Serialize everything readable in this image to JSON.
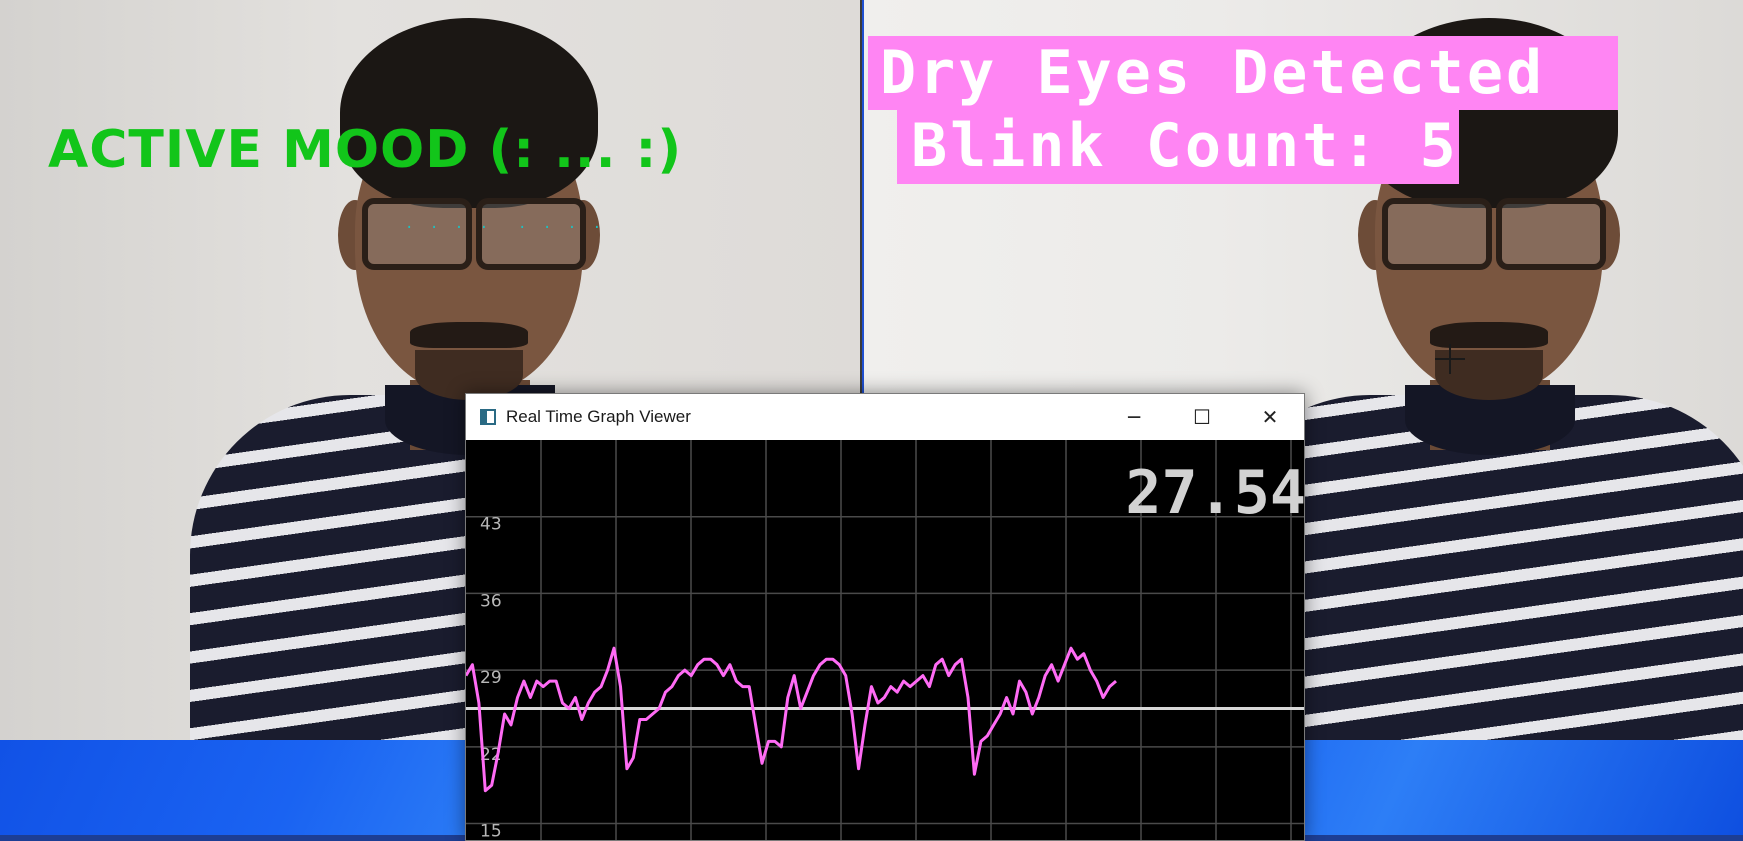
{
  "overlay": {
    "mood_text": "ACTIVE MOOD (: ... :)",
    "alert_line1": "Dry Eyes Detected",
    "alert_line2": "Blink Count: 5",
    "eye_landmarks": "· · · ·",
    "colors": {
      "mood": "#12c51a",
      "alert_bg": "#ff85f3",
      "alert_text": "#ffffff"
    }
  },
  "graph_window": {
    "title": "Real Time Graph Viewer",
    "icon": "app-icon",
    "controls": {
      "minimize": "─",
      "maximize": "☐",
      "close": "✕"
    },
    "current_value": "27.54"
  },
  "chart_data": {
    "type": "line",
    "title": "",
    "xlabel": "",
    "ylabel": "",
    "y_tick_labels": [
      "43",
      "36",
      "29",
      "22",
      "15"
    ],
    "ylim": [
      13.5,
      50
    ],
    "grid": true,
    "threshold": 25.5,
    "series_color": "#ff6bf5",
    "threshold_color": "#d8d8d8",
    "values": [
      28.5,
      29.5,
      26,
      18,
      18.5,
      21.5,
      25,
      24,
      26.5,
      28,
      26.5,
      28,
      27.5,
      28,
      28,
      26,
      25.5,
      26.5,
      24.5,
      26,
      27,
      27.5,
      29,
      31,
      27.5,
      20,
      21,
      24.5,
      24.5,
      25,
      25.5,
      27,
      27.5,
      28.5,
      29,
      28.5,
      29.5,
      30,
      30,
      29.5,
      28.5,
      29.5,
      28,
      27.5,
      27.5,
      24,
      20.5,
      22.5,
      22.5,
      22,
      26.5,
      28.5,
      25.5,
      27,
      28.5,
      29.5,
      30,
      30,
      29.5,
      28.5,
      25,
      20,
      24,
      27.5,
      26,
      26.5,
      27.5,
      27,
      28,
      27.5,
      28,
      28.5,
      27.5,
      29.5,
      30,
      28.5,
      29.5,
      30,
      26.5,
      19.5,
      22.5,
      23,
      24,
      25,
      26.5,
      25,
      28,
      27,
      25,
      26.5,
      28.5,
      29.5,
      28,
      29.5,
      31,
      30,
      30.5,
      29,
      28,
      26.5,
      27.5,
      28
    ]
  }
}
